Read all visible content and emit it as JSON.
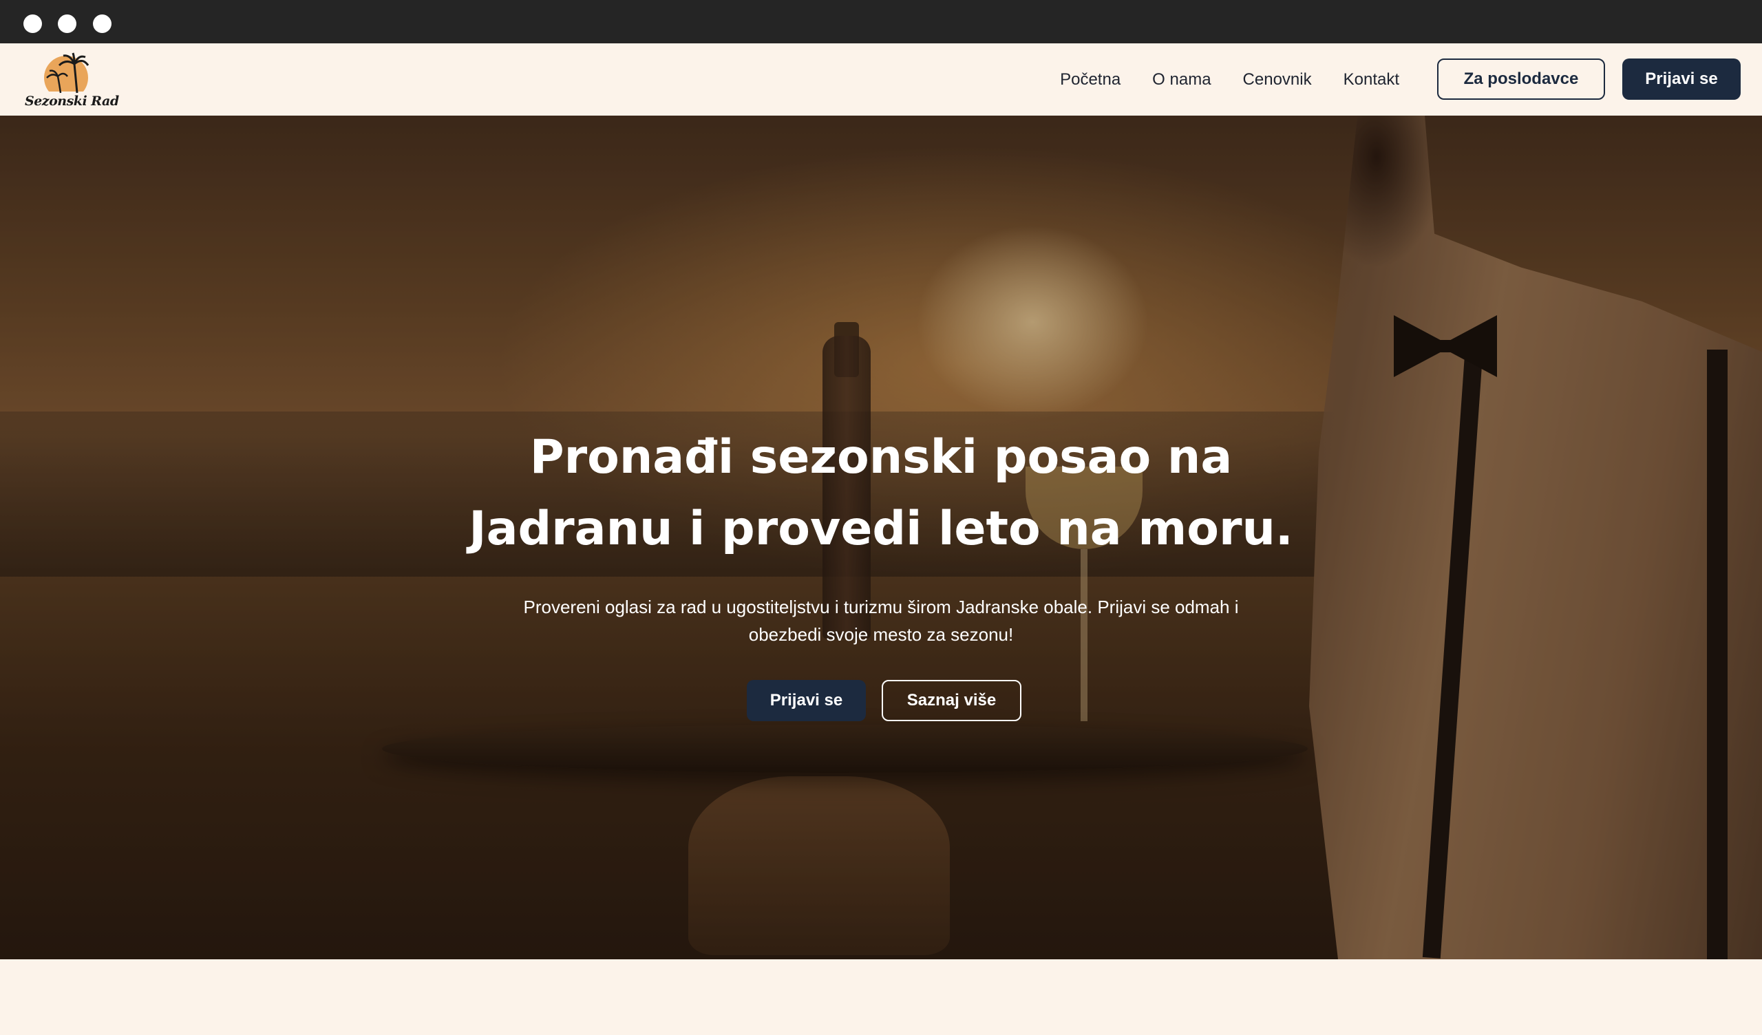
{
  "window": {
    "controls": [
      "close-dot",
      "minimize-dot",
      "maximize-dot"
    ]
  },
  "brand": {
    "name": "Sezonski Rad",
    "logo_icon": "palm-tree-sun-icon",
    "logo_color": "#e9a55a"
  },
  "nav": {
    "links": [
      {
        "label": "Početna"
      },
      {
        "label": "O nama"
      },
      {
        "label": "Cenovnik"
      },
      {
        "label": "Kontakt"
      }
    ],
    "employer_button": "Za poslodavce",
    "signup_button": "Prijavi se"
  },
  "hero": {
    "title_line1": "Pronađi sezonski posao na",
    "title_line2": "Jadranu i provedi leto na moru.",
    "subtitle_line1": "Provereni oglasi za rad u ugostiteljstvu i turizmu širom Jadranske obale. Prijavi se odmah i",
    "subtitle_line2": "obezbedi svoje mesto za sezonu!",
    "primary_button": "Prijavi se",
    "secondary_button": "Saznaj više"
  },
  "colors": {
    "page_bg": "#fcf3ea",
    "titlebar_bg": "#252525",
    "primary_dark": "#1c2a3f",
    "hero_text": "#ffffff"
  }
}
